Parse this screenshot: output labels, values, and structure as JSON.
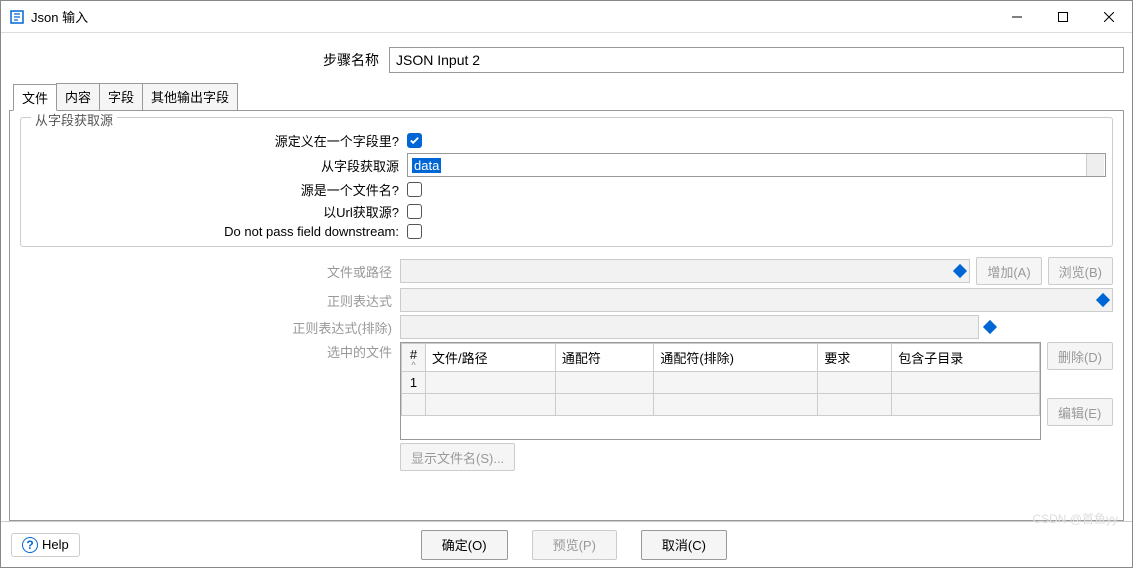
{
  "window": {
    "title": "Json 输入"
  },
  "step": {
    "label": "步骤名称",
    "value": "JSON Input 2"
  },
  "tabs": [
    "文件",
    "内容",
    "字段",
    "其他输出字段"
  ],
  "active_tab": 0,
  "fieldset": {
    "legend": "从字段获取源",
    "rows": {
      "source_in_field": {
        "label": "源定义在一个字段里?",
        "checked": true
      },
      "get_from_field": {
        "label": "从字段获取源",
        "value": "data"
      },
      "is_filename": {
        "label": "源是一个文件名?",
        "checked": false
      },
      "by_url": {
        "label": "以Url获取源?",
        "checked": false
      },
      "no_pass": {
        "label": "Do not pass field downstream:",
        "checked": false
      }
    }
  },
  "file_section": {
    "file_or_path": "文件或路径",
    "regex": "正则表达式",
    "regex_exclude": "正则表达式(排除)",
    "selected_files": "选中的文件"
  },
  "table": {
    "headers": [
      "#",
      "文件/路径",
      "通配符",
      "通配符(排除)",
      "要求",
      "包含子目录"
    ],
    "rows": [
      {
        "num": "1",
        "cells": [
          "",
          "",
          "",
          "",
          ""
        ]
      }
    ]
  },
  "buttons": {
    "add": "增加(A)",
    "browse": "浏览(B)",
    "delete": "删除(D)",
    "edit": "编辑(E)",
    "show_filename": "显示文件名(S)...",
    "ok": "确定(O)",
    "preview": "预览(P)",
    "cancel": "取消(C)",
    "help": "Help"
  },
  "watermark": "CSDN @首鱼yy"
}
